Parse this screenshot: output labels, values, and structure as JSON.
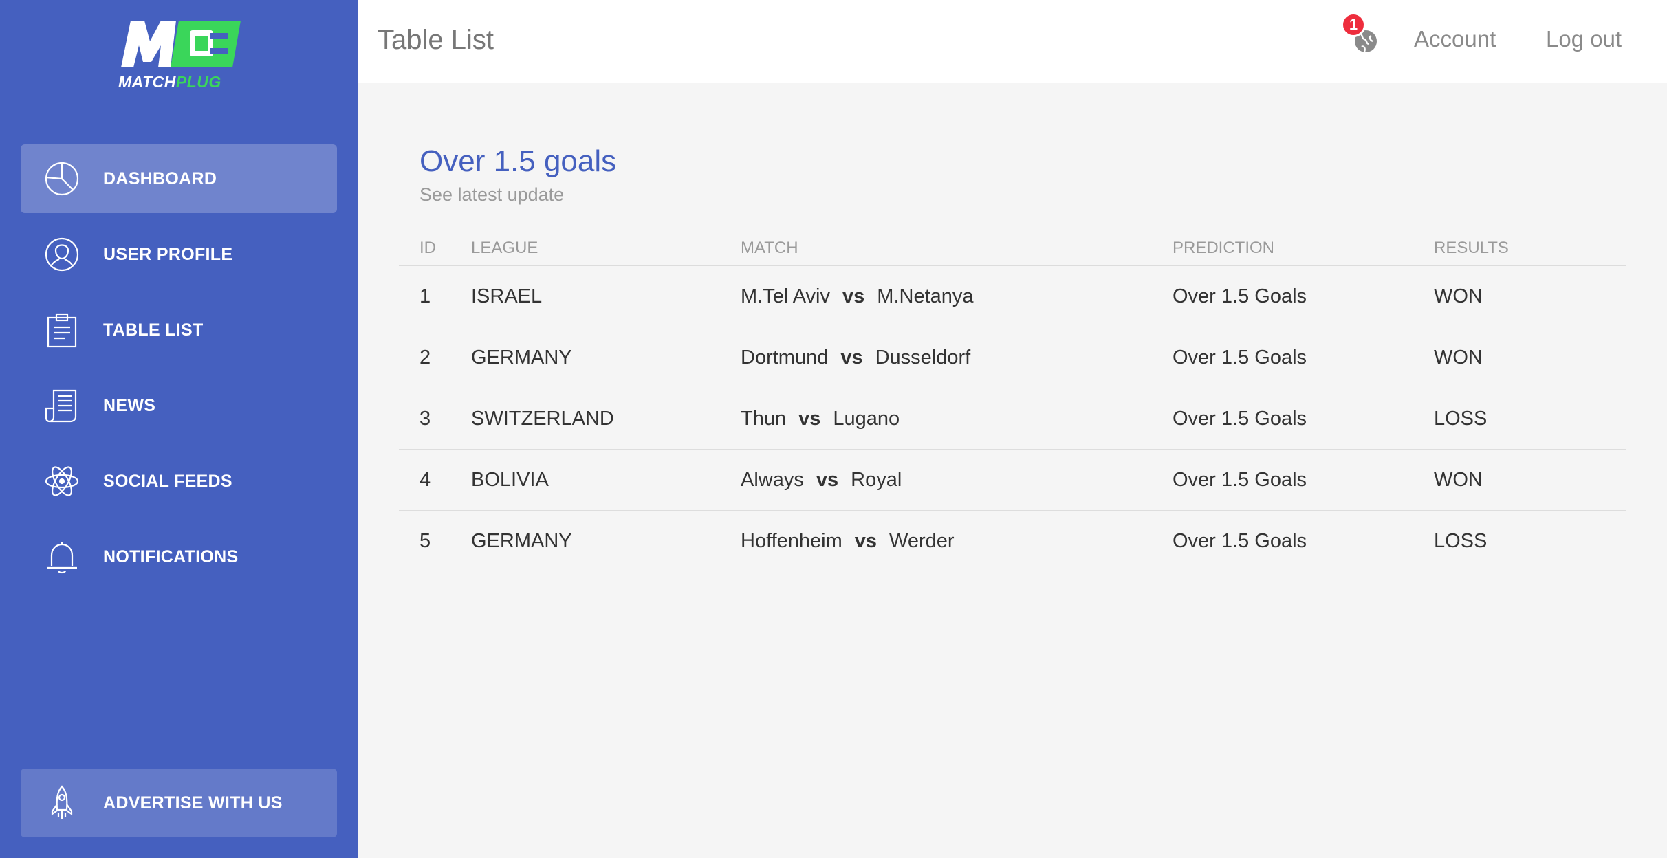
{
  "brand": {
    "name_part1": "MATCH",
    "name_part2": "PLUG",
    "green": "#3ad65a",
    "accent": "#4560bf"
  },
  "sidebar": {
    "items": [
      {
        "label": "DASHBOARD",
        "icon": "pie-chart-icon",
        "active": true
      },
      {
        "label": "USER PROFILE",
        "icon": "user-icon",
        "active": false
      },
      {
        "label": "TABLE LIST",
        "icon": "clipboard-icon",
        "active": false
      },
      {
        "label": "NEWS",
        "icon": "newspaper-icon",
        "active": false
      },
      {
        "label": "SOCIAL FEEDS",
        "icon": "atom-icon",
        "active": false
      },
      {
        "label": "NOTIFICATIONS",
        "icon": "bell-icon",
        "active": false
      }
    ],
    "advertise": {
      "label": "ADVERTISE WITH US",
      "icon": "rocket-icon"
    }
  },
  "header": {
    "title": "Table List",
    "notification_count": "1",
    "account_label": "Account",
    "logout_label": "Log out"
  },
  "card": {
    "title": "Over 1.5 goals",
    "subtitle": "See latest update"
  },
  "table": {
    "headers": [
      "ID",
      "LEAGUE",
      "MATCH",
      "PREDICTION",
      "RESULTS"
    ],
    "vs_label": "vs",
    "rows": [
      {
        "id": "1",
        "league": "ISRAEL",
        "home": "M.Tel Aviv",
        "away": "M.Netanya",
        "prediction": "Over 1.5 Goals",
        "result": "WON"
      },
      {
        "id": "2",
        "league": "GERMANY",
        "home": "Dortmund",
        "away": "Dusseldorf",
        "prediction": "Over 1.5 Goals",
        "result": "WON"
      },
      {
        "id": "3",
        "league": "SWITZERLAND",
        "home": "Thun",
        "away": "Lugano",
        "prediction": "Over 1.5 Goals",
        "result": "LOSS"
      },
      {
        "id": "4",
        "league": "BOLIVIA",
        "home": "Always",
        "away": "Royal",
        "prediction": "Over 1.5 Goals",
        "result": "WON"
      },
      {
        "id": "5",
        "league": "GERMANY",
        "home": "Hoffenheim",
        "away": "Werder",
        "prediction": "Over 1.5 Goals",
        "result": "LOSS"
      }
    ]
  }
}
